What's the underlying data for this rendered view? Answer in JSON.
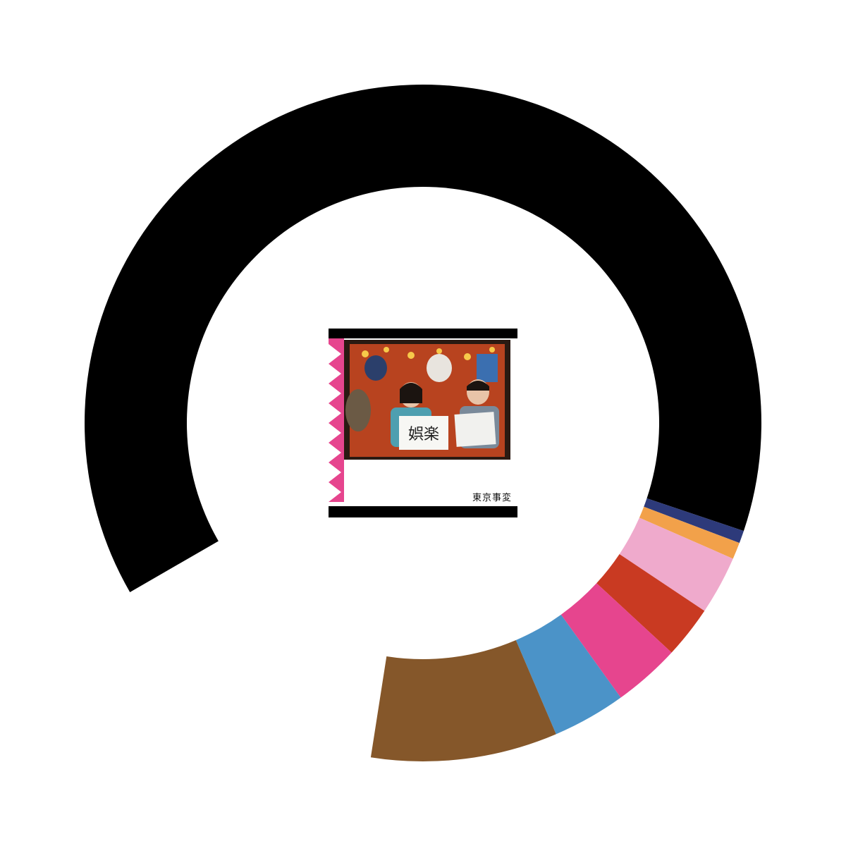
{
  "chart_data": {
    "type": "pie",
    "style": "donut",
    "start_angle_deg": 240,
    "direction": "clockwise",
    "values": [
      63.5,
      0.6,
      0.8,
      2.8,
      2.5,
      3.2,
      3.5,
      8.9
    ],
    "colors": [
      "#000000",
      "#2d3a7a",
      "#f2a14a",
      "#efaacc",
      "#c93a22",
      "#e6458e",
      "#4b93c8",
      "#85572a"
    ],
    "title": "",
    "legend": []
  },
  "thumbnail": {
    "sign_text": "娯楽",
    "caption": "東京事変",
    "zigzag_color": "#e6458e"
  }
}
